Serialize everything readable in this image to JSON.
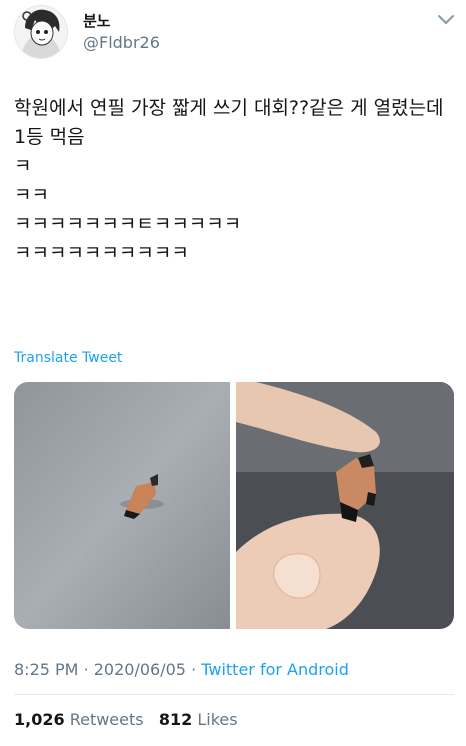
{
  "author": {
    "display_name": "분노",
    "handle": "@Fldbr26",
    "avatar_icon": "anime-character-avatar"
  },
  "tweet": {
    "text": "학원에서 연필 가장 짧게 쓰기 대회??같은 게 열렸는데 1등 먹음\nㅋ\nㅋㅋ\nㅋㅋㅋㅋㅋㅋㅋㅌㅋㅋㅋㅋㅋ\nㅋㅋㅋㅋㅋㅋㅋㅋㅋㅋ",
    "translate_label": "Translate Tweet"
  },
  "media": {
    "photos": [
      {
        "icon": "pencil-stub-on-table-photo"
      },
      {
        "icon": "pencil-stub-held-in-fingers-photo"
      }
    ]
  },
  "meta": {
    "time": "8:25 PM",
    "separator": "·",
    "date": "2020/06/05",
    "source": "Twitter for Android"
  },
  "stats": {
    "retweets_count": "1,026",
    "retweets_label": "Retweets",
    "likes_count": "812",
    "likes_label": "Likes"
  },
  "colors": {
    "link": "#1da1f2",
    "secondary": "#657786",
    "text": "#14171a"
  }
}
